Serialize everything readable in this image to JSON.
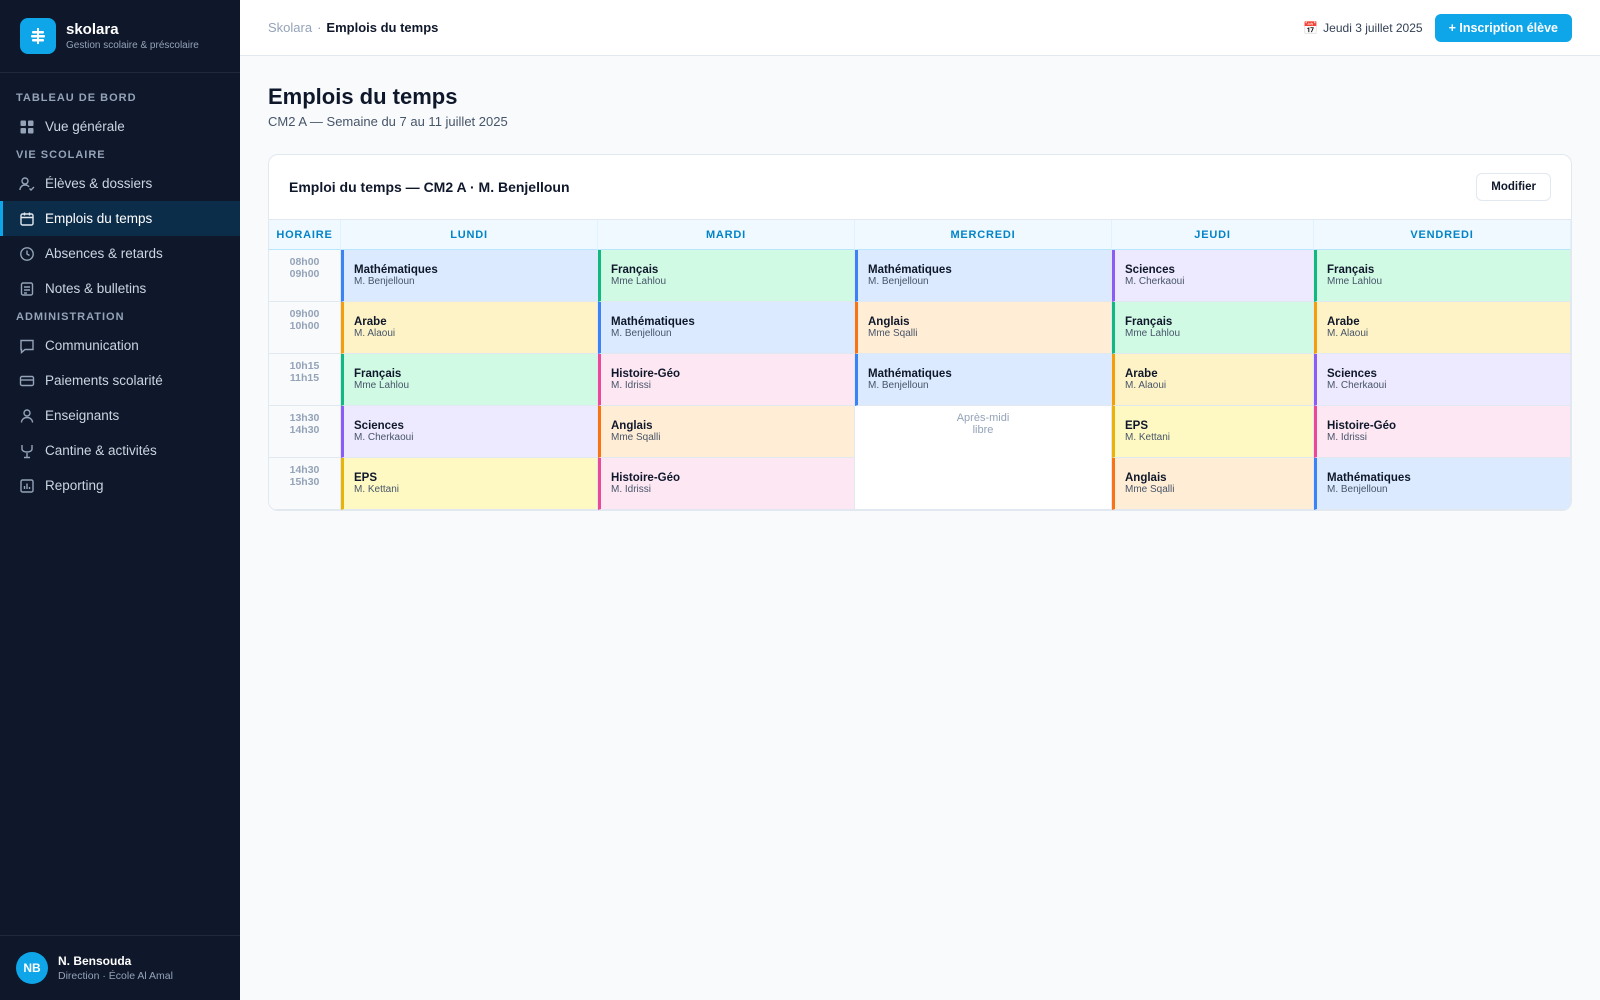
{
  "brand": {
    "name": "skolara",
    "subtitle": "Gestion scolaire & préscolaire"
  },
  "nav": {
    "sections": [
      {
        "label": "TABLEAU DE BORD",
        "items": [
          {
            "label": "Vue générale",
            "icon": "grid-icon"
          }
        ]
      },
      {
        "label": "VIE SCOLAIRE",
        "items": [
          {
            "label": "Élèves & dossiers",
            "icon": "user-check-icon"
          },
          {
            "label": "Emplois du temps",
            "icon": "calendar-icon",
            "active": true
          },
          {
            "label": "Absences & retards",
            "icon": "clock-icon"
          },
          {
            "label": "Notes & bulletins",
            "icon": "document-icon"
          }
        ]
      },
      {
        "label": "ADMINISTRATION",
        "items": [
          {
            "label": "Communication",
            "icon": "chat-icon"
          },
          {
            "label": "Paiements scolarité",
            "icon": "credit-card-icon"
          },
          {
            "label": "Enseignants",
            "icon": "user-icon"
          },
          {
            "label": "Cantine & activités",
            "icon": "utensils-icon"
          },
          {
            "label": "Reporting",
            "icon": "bar-chart-icon"
          }
        ]
      }
    ]
  },
  "user": {
    "initials": "NB",
    "name": "N. Bensouda",
    "role": "Direction · École Al Amal"
  },
  "topbar": {
    "breadcrumb_root": "Skolara",
    "breadcrumb_sep": "·",
    "breadcrumb_current": "Emplois du temps",
    "date_icon": "📅",
    "date": "Jeudi 3 juillet 2025",
    "primary_button": "+ Inscription élève"
  },
  "page": {
    "title": "Emplois du temps",
    "subtitle": "CM2 A — Semaine du 7 au 11 juillet 2025"
  },
  "timetable": {
    "title": "Emploi du temps — CM2 A · M. Benjelloun",
    "edit_button": "Modifier",
    "headers": [
      "HORAIRE",
      "LUNDI",
      "MARDI",
      "MERCREDI",
      "JEUDI",
      "VENDREDI"
    ],
    "free_label": "Après-midi libre",
    "rows": [
      {
        "time": [
          "08h00",
          "09h00"
        ],
        "slots": [
          {
            "subject": "Mathématiques",
            "teacher": "M. Benjelloun",
            "kind": "math"
          },
          {
            "subject": "Français",
            "teacher": "Mme Lahlou",
            "kind": "fr"
          },
          {
            "subject": "Mathématiques",
            "teacher": "M. Benjelloun",
            "kind": "math"
          },
          {
            "subject": "Sciences",
            "teacher": "M. Cherkaoui",
            "kind": "sci"
          },
          {
            "subject": "Français",
            "teacher": "Mme Lahlou",
            "kind": "fr"
          }
        ]
      },
      {
        "time": [
          "09h00",
          "10h00"
        ],
        "slots": [
          {
            "subject": "Arabe",
            "teacher": "M. Alaoui",
            "kind": "ar"
          },
          {
            "subject": "Mathématiques",
            "teacher": "M. Benjelloun",
            "kind": "math"
          },
          {
            "subject": "Anglais",
            "teacher": "Mme Sqalli",
            "kind": "en"
          },
          {
            "subject": "Français",
            "teacher": "Mme Lahlou",
            "kind": "fr"
          },
          {
            "subject": "Arabe",
            "teacher": "M. Alaoui",
            "kind": "ar"
          }
        ]
      },
      {
        "time": [
          "10h15",
          "11h15"
        ],
        "slots": [
          {
            "subject": "Français",
            "teacher": "Mme Lahlou",
            "kind": "fr"
          },
          {
            "subject": "Histoire-Géo",
            "teacher": "M. Idrissi",
            "kind": "hg"
          },
          {
            "subject": "Mathématiques",
            "teacher": "M. Benjelloun",
            "kind": "math"
          },
          {
            "subject": "Arabe",
            "teacher": "M. Alaoui",
            "kind": "ar"
          },
          {
            "subject": "Sciences",
            "teacher": "M. Cherkaoui",
            "kind": "sci"
          }
        ]
      },
      {
        "time": [
          "13h30",
          "14h30"
        ],
        "slots": [
          {
            "subject": "Sciences",
            "teacher": "M. Cherkaoui",
            "kind": "sci"
          },
          {
            "subject": "Anglais",
            "teacher": "Mme Sqalli",
            "kind": "en"
          },
          {
            "free": true
          },
          {
            "subject": "EPS",
            "teacher": "M. Kettani",
            "kind": "eps"
          },
          {
            "subject": "Histoire-Géo",
            "teacher": "M. Idrissi",
            "kind": "hg"
          }
        ]
      },
      {
        "time": [
          "14h30",
          "15h30"
        ],
        "slots": [
          {
            "subject": "EPS",
            "teacher": "M. Kettani",
            "kind": "eps"
          },
          {
            "subject": "Histoire-Géo",
            "teacher": "M. Idrissi",
            "kind": "hg"
          },
          {
            "skip": true
          },
          {
            "subject": "Anglais",
            "teacher": "Mme Sqalli",
            "kind": "en"
          },
          {
            "subject": "Mathématiques",
            "teacher": "M. Benjelloun",
            "kind": "math"
          }
        ]
      }
    ]
  },
  "colors": {
    "accent": "#0ea5e9",
    "sidebar": "#0f172a"
  }
}
